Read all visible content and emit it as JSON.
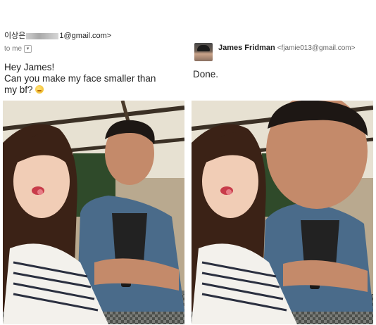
{
  "request": {
    "sender_prefix": "이상은",
    "sender_suffix": "1@gmail.com>",
    "to_label": "to me",
    "dropdown_glyph": "▾",
    "line1": "Hey James!",
    "line2": "Can you make my face smaller than",
    "line3": "my bf?"
  },
  "reply": {
    "name": "James Fridman",
    "email": "<fjamie013@gmail.com>",
    "text": "Done."
  }
}
